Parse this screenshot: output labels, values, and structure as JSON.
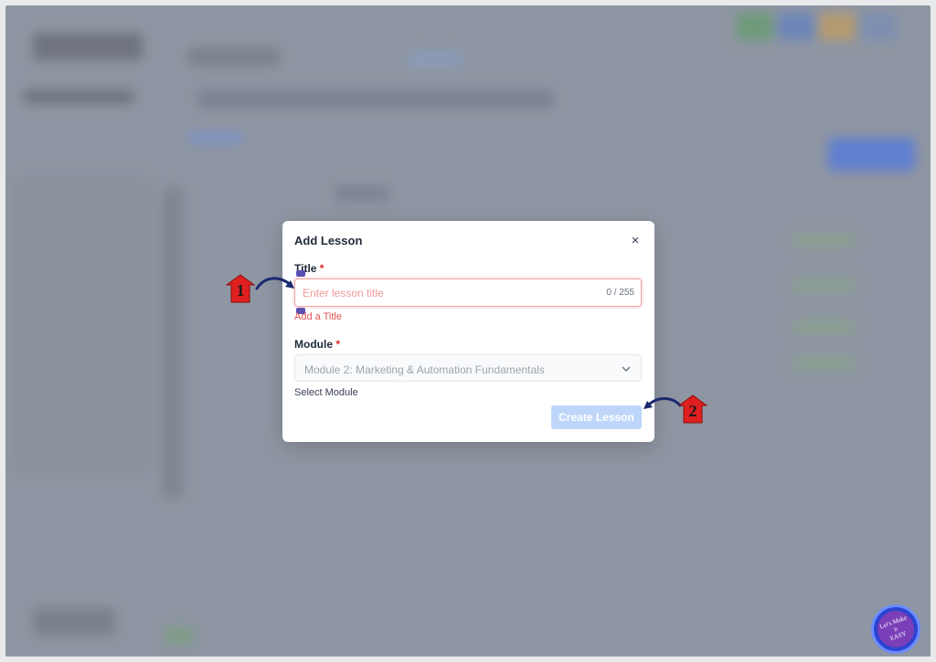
{
  "modal": {
    "title": "Add Lesson",
    "close_glyph": "×",
    "title_field": {
      "label": "Title",
      "required_mark": "*",
      "placeholder": "Enter lesson title",
      "value": "",
      "counter": "0 / 255",
      "error": "Add a Title"
    },
    "module_field": {
      "label": "Module",
      "required_mark": "*",
      "selected": "Module 2: Marketing & Automation Fundamentals",
      "helper": "Select Module"
    },
    "submit_label": "Create Lesson"
  },
  "annotations": {
    "step1": "1",
    "step2": "2"
  },
  "watermark": "Let's Make It EASY",
  "colors": {
    "overlay": "#8f96a3",
    "error": "#e05252",
    "button_disabled": "#bfd6fb",
    "annotation_badge": "#e02020"
  }
}
